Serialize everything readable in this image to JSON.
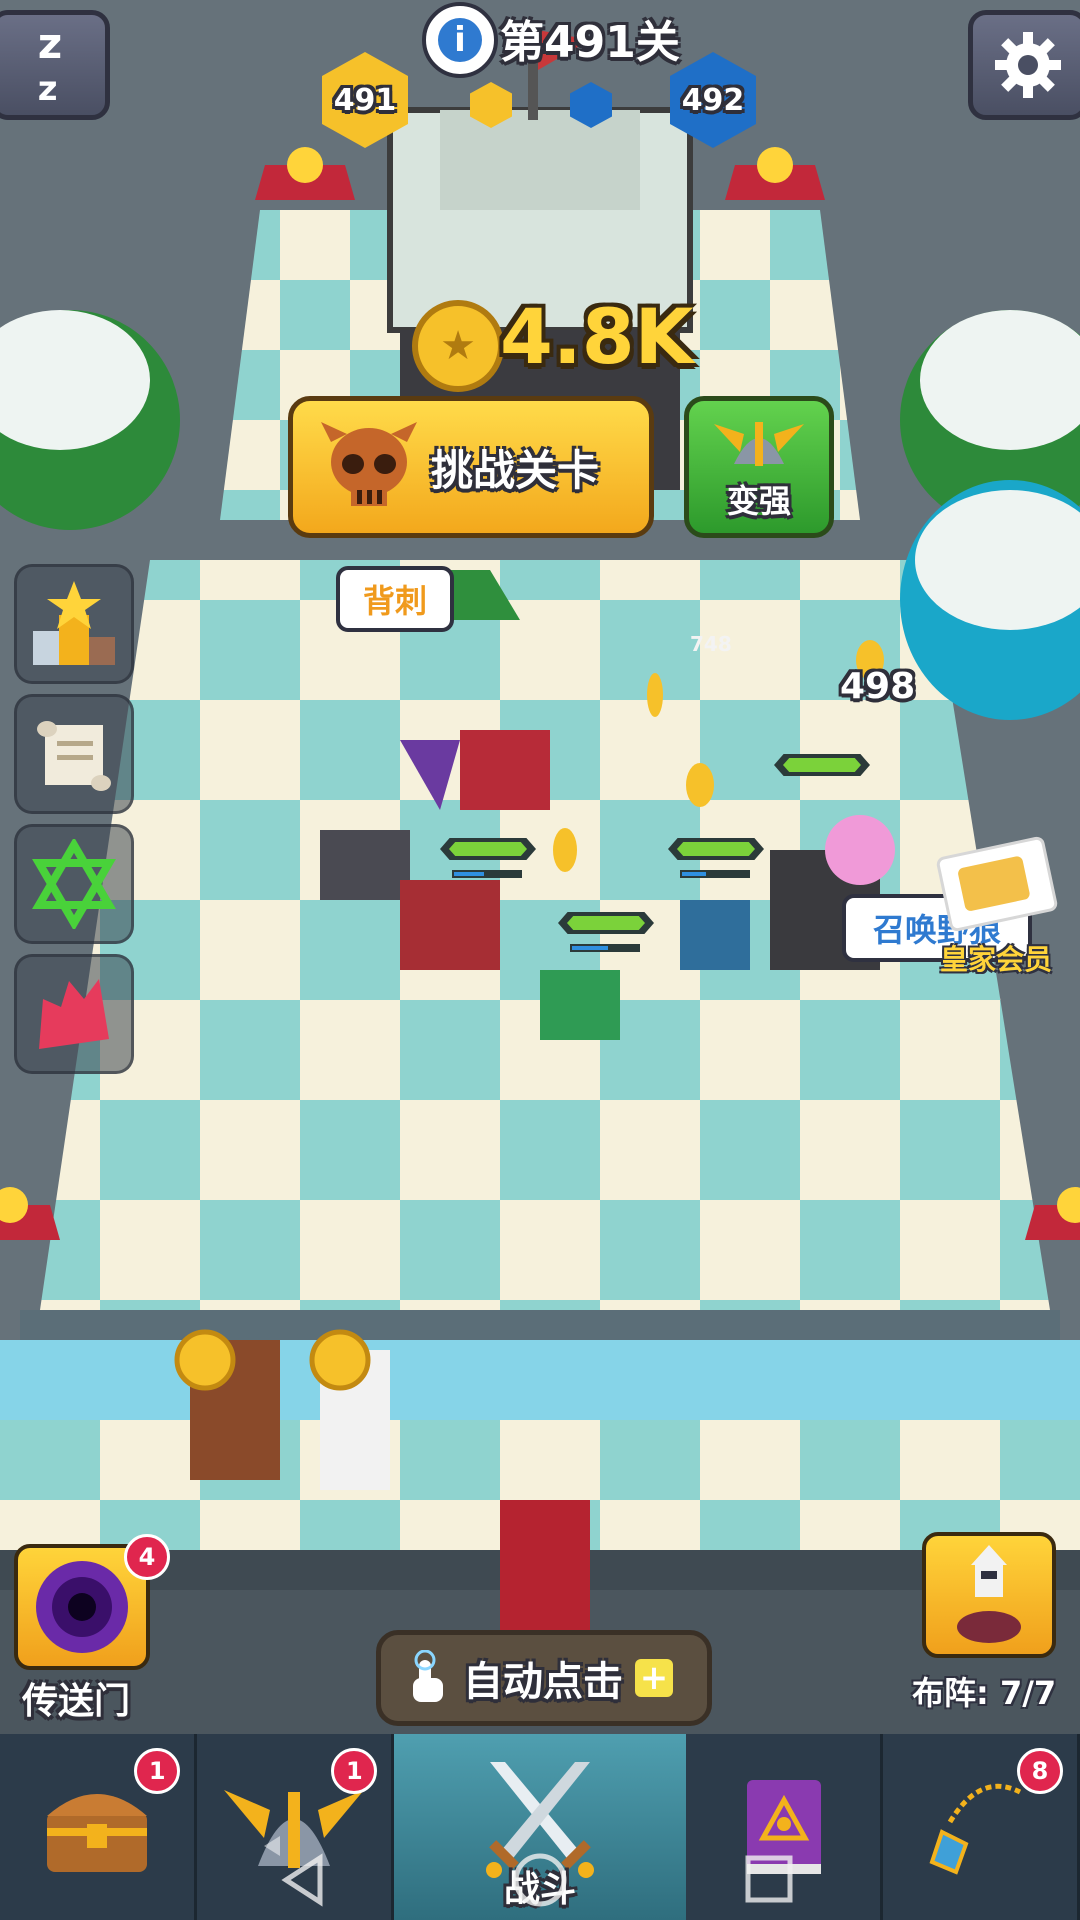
{
  "top_bar": {
    "level_title": "第491关",
    "current_level": "491",
    "next_level": "492"
  },
  "reward": {
    "coins": "4.8K"
  },
  "actions": {
    "challenge_label": "挑战关卡",
    "upgrade_label": "变强"
  },
  "labels": {
    "backstab": "背刺",
    "summon": "召唤野狼",
    "royal": "皇家会员"
  },
  "damage_numbers": [
    "748",
    "498"
  ],
  "portal": {
    "label": "传送门",
    "badge": "4"
  },
  "formation": {
    "label": "布阵:",
    "value": "7/7"
  },
  "auto_click": {
    "label": "自动点击",
    "plus": "+"
  },
  "nav": {
    "items": [
      {
        "name": "chest",
        "badge": "1"
      },
      {
        "name": "helmet",
        "badge": "1"
      },
      {
        "name": "battle",
        "label": "战斗"
      },
      {
        "name": "book"
      },
      {
        "name": "amulet",
        "badge": "8"
      }
    ]
  },
  "colors": {
    "board_light": "#f6f1dc",
    "board_teal": "#8fd3cf",
    "gold": "#f6c12a",
    "green": "#43b94a",
    "blue_hex": "#1f6fc7"
  }
}
